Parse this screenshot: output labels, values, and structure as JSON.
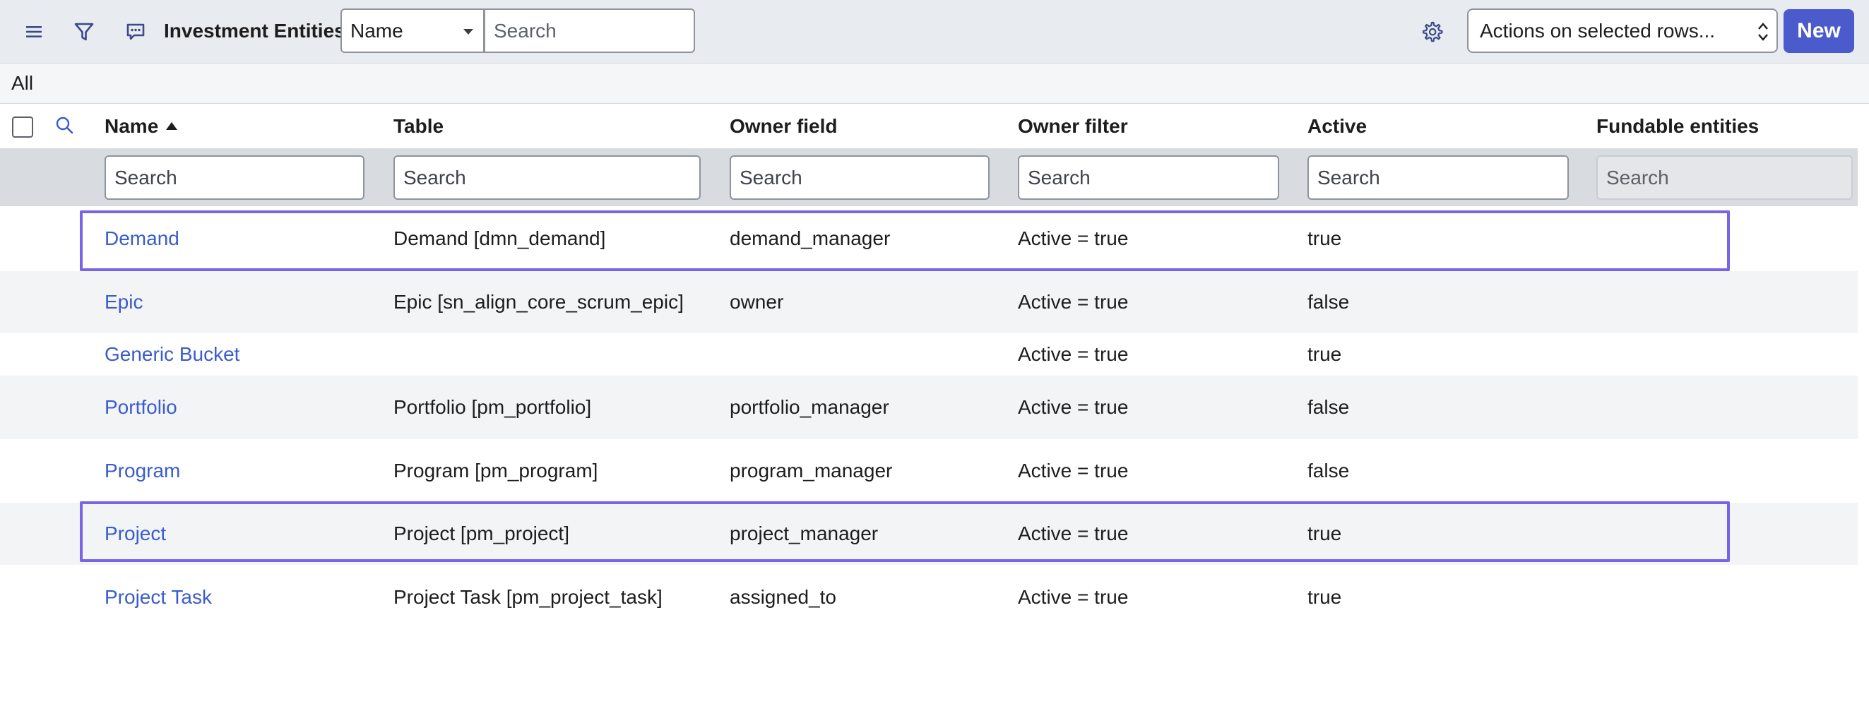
{
  "header": {
    "title": "Investment Entities",
    "field_select": "Name",
    "search_placeholder": "Search",
    "actions_select": "Actions on selected rows...",
    "new_label": "New"
  },
  "breadcrumb": "All",
  "columns": {
    "name": "Name",
    "table": "Table",
    "owner_field": "Owner field",
    "owner_filter": "Owner filter",
    "active": "Active",
    "fundable": "Fundable entities"
  },
  "filter_placeholder": "Search",
  "rows": [
    {
      "name": "Demand",
      "table": "Demand [dmn_demand]",
      "owner_field": "demand_manager",
      "owner_filter": "Active = true",
      "active": "true"
    },
    {
      "name": "Epic",
      "table": "Epic [sn_align_core_scrum_epic]",
      "owner_field": "owner",
      "owner_filter": "Active = true",
      "active": "false"
    },
    {
      "name": "Generic Bucket",
      "table": "",
      "owner_field": "",
      "owner_filter": "Active = true",
      "active": "true"
    },
    {
      "name": "Portfolio",
      "table": "Portfolio [pm_portfolio]",
      "owner_field": "portfolio_manager",
      "owner_filter": "Active = true",
      "active": "false"
    },
    {
      "name": "Program",
      "table": "Program [pm_program]",
      "owner_field": "program_manager",
      "owner_filter": "Active = true",
      "active": "false"
    },
    {
      "name": "Project",
      "table": "Project [pm_project]",
      "owner_field": "project_manager",
      "owner_filter": "Active = true",
      "active": "true"
    },
    {
      "name": "Project Task",
      "table": "Project Task [pm_project_task]",
      "owner_field": "assigned_to",
      "owner_filter": "Active = true",
      "active": "true"
    }
  ],
  "icons": {
    "menu": "hamburger-menu-icon",
    "filter": "filter-funnel-icon",
    "comment": "comment-bubble-icon",
    "settings": "gear-icon",
    "column_search": "magnifier-icon"
  },
  "colors": {
    "accent": "#4b5bcb",
    "link": "#3a5ccc",
    "highlight": "#7b63e8",
    "header_bg": "#e8ebef"
  }
}
